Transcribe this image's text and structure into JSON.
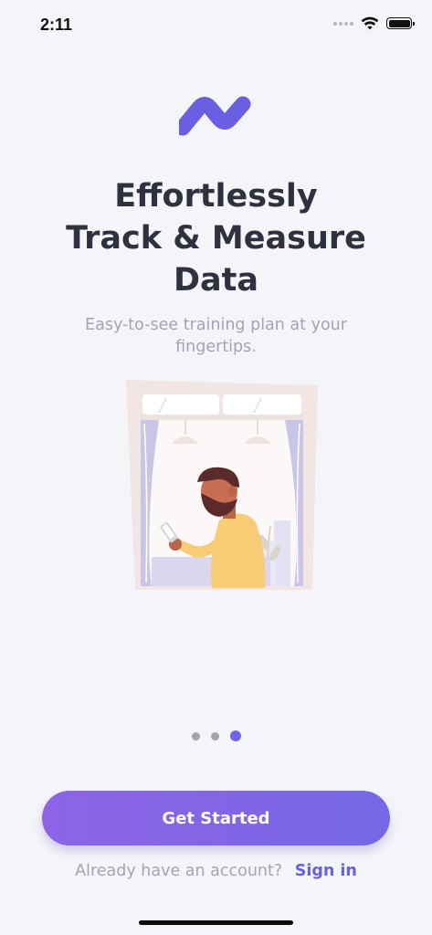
{
  "status_bar": {
    "time": "2:11",
    "icons": [
      "signal-dots-icon",
      "wifi-icon",
      "battery-icon"
    ]
  },
  "logo": {
    "icon": "brand-wave-logo",
    "color": "#6a5ee3"
  },
  "onboarding": {
    "headline_lines": [
      "Effortlessly",
      "Track & Measure",
      "Data"
    ],
    "subtitle": "Easy-to-see training plan at your fingertips.",
    "illustration": "man-with-phone-at-window-illustration"
  },
  "pager": {
    "total": 3,
    "active_index": 2
  },
  "actions": {
    "primary_label": "Get Started",
    "account_prompt": "Already have an account?",
    "signin_label": "Sign in"
  },
  "colors": {
    "background": "#f4f5f9",
    "accent": "#6a5ee3",
    "button_gradient_start": "#8e63e7",
    "button_gradient_end": "#7568e6",
    "headline": "#2f3040",
    "muted_text": "#a4a3b6"
  }
}
